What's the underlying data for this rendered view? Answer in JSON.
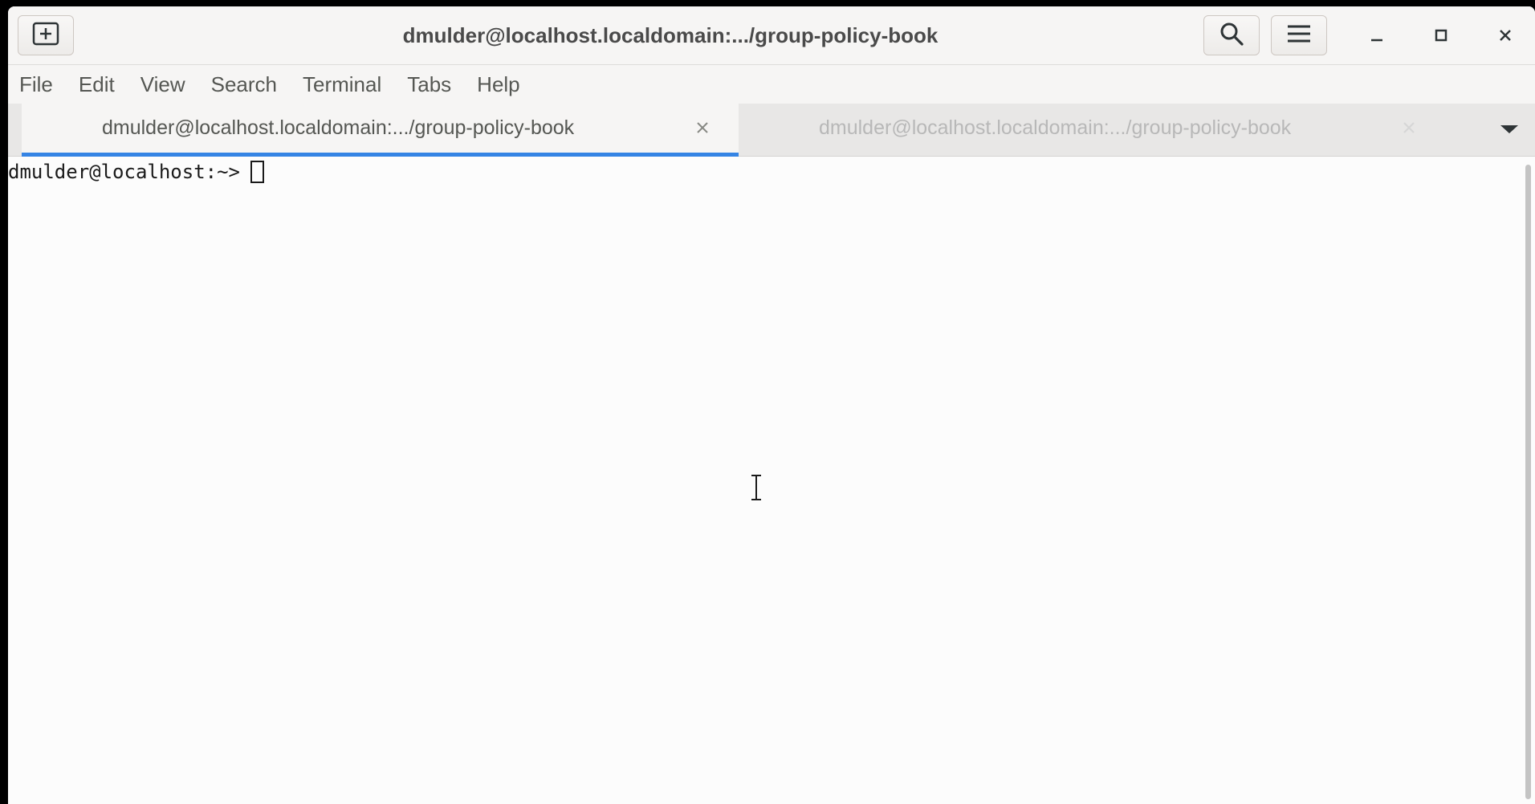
{
  "window": {
    "title": "dmulder@localhost.localdomain:.../group-policy-book"
  },
  "headerbar": {
    "new_tab_icon": "tab-new-icon",
    "search_icon": "search-icon",
    "menu_icon": "hamburger-menu-icon",
    "minimize_icon": "minimize-icon",
    "maximize_icon": "maximize-icon",
    "close_icon": "close-icon"
  },
  "menubar": {
    "items": [
      {
        "label": "File"
      },
      {
        "label": "Edit"
      },
      {
        "label": "View"
      },
      {
        "label": "Search"
      },
      {
        "label": "Terminal"
      },
      {
        "label": "Tabs"
      },
      {
        "label": "Help"
      }
    ]
  },
  "tabs": [
    {
      "label": "dmulder@localhost.localdomain:.../group-policy-book",
      "active": true
    },
    {
      "label": "dmulder@localhost.localdomain:.../group-policy-book",
      "active": false
    }
  ],
  "terminal": {
    "prompt": "dmulder@localhost:~>"
  },
  "colors": {
    "accent": "#3584e4",
    "terminal_bg": "#fcfcfc",
    "terminal_fg": "#1a1a1a"
  }
}
